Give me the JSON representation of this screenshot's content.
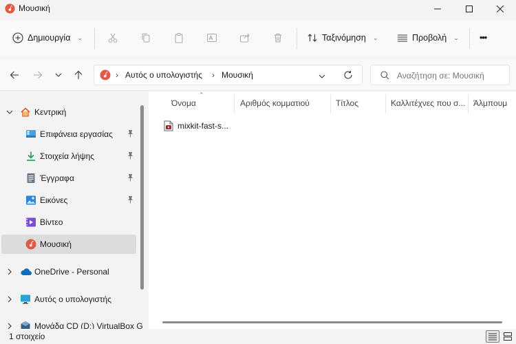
{
  "window": {
    "title": "Μουσική"
  },
  "toolbar": {
    "new_label": "Δημιουργία",
    "sort_label": "Ταξινόμηση",
    "view_label": "Προβολή",
    "more_label": "•••"
  },
  "address": {
    "crumbs": [
      "Αυτός ο υπολογιστής",
      "Μουσική"
    ]
  },
  "search": {
    "placeholder": "Αναζήτηση σε: Μουσική"
  },
  "sidebar": {
    "items": [
      {
        "label": "Κεντρική"
      },
      {
        "label": "Επιφάνεια εργασίας"
      },
      {
        "label": "Στοιχεία λήψης"
      },
      {
        "label": "Έγγραφα"
      },
      {
        "label": "Εικόνες"
      },
      {
        "label": "Βίντεο"
      },
      {
        "label": "Μουσική"
      },
      {
        "label": "OneDrive - Personal"
      },
      {
        "label": "Αυτός ο υπολογιστής"
      },
      {
        "label": "Μονάδα CD (D:) VirtualBox G"
      }
    ]
  },
  "columns": [
    "Όνομα",
    "Αριθμός κομματιού",
    "Τίτλος",
    "Καλλιτέχνες που σ...",
    "Άλμπουμ"
  ],
  "files": [
    {
      "name": "mixkit-fast-s..."
    }
  ],
  "status": {
    "count": "1 στοιχείο"
  },
  "colors": {
    "accent": "#0067c0",
    "music_icon": "#e05a47",
    "selected_bg": "#dcdcdc"
  }
}
